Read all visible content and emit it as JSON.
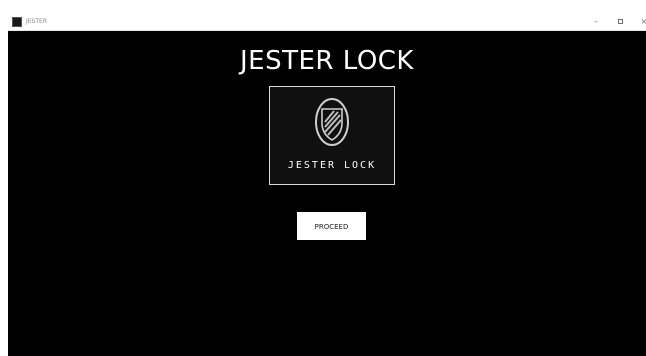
{
  "window": {
    "title": "JESTER",
    "controls": {
      "minimize": "–",
      "close": "×"
    }
  },
  "main": {
    "title": "JESTER LOCK",
    "logo": {
      "icon": "shield-icon",
      "text": "JESTER LOCK"
    },
    "proceed_label": "PROCEED"
  },
  "colors": {
    "background": "#000000",
    "text": "#ffffff",
    "button_bg": "#ffffff"
  }
}
